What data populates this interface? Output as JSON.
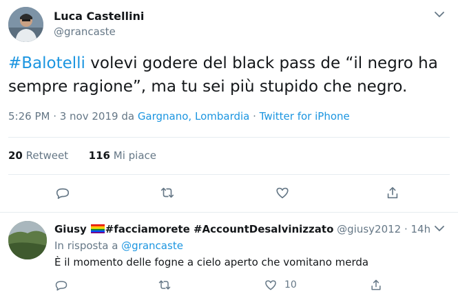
{
  "tweet": {
    "author_name": "Luca Castellini",
    "author_handle": "@grancaste",
    "hashtag": "#Balotelli",
    "text_after_hashtag": " volevi godere del black pass de “il negro ha sempre ragione”, ma tu sei più stupido che negro.",
    "time": "5:26 PM · 3 nov 2019 da ",
    "location": "Gargnano, Lombardia",
    "meta_sep": " · ",
    "source": "Twitter for iPhone",
    "retweet_count": "20",
    "retweet_label": " Retweet",
    "like_count": "116",
    "like_label": " Mi piace"
  },
  "reply": {
    "author_name": "Giusy",
    "tags": "#facciamorete #AccountDesalvinizzato",
    "handle_time": " @giusy2012 · 14h",
    "in_reply_prefix": "In risposta a ",
    "in_reply_handle": "@grancaste",
    "text": "È il momento delle fogne a cielo aperto che vomitano merda",
    "like_count": "10"
  },
  "icons": {
    "main_actions": [
      "reply-icon",
      "retweet-icon",
      "like-icon",
      "share-icon"
    ],
    "reply_actions": [
      "reply-icon",
      "retweet-icon",
      "like-icon",
      "share-icon"
    ],
    "menu": "chevron-down-icon"
  },
  "colors": {
    "link": "#1b95e0",
    "muted": "#657786",
    "text": "#14171a",
    "divider": "#e6ecf0"
  }
}
